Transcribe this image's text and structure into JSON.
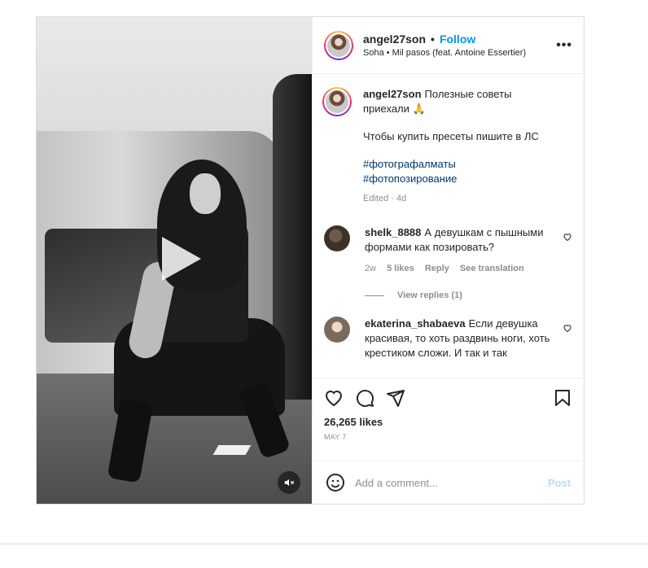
{
  "post": {
    "username": "angel27son",
    "follow_label": "Follow",
    "separator": "•",
    "audio": "Soha • Mil pasos (feat. Antoine Essertier)",
    "more_label": "•••"
  },
  "caption": {
    "username": "angel27son",
    "line1": "Полезные советы приехали 🙏",
    "line2": "Чтобы купить пресеты пишите в ЛС",
    "tags": [
      "#фотографалматы",
      "#фотопозирование"
    ],
    "meta": "Edited · 4d"
  },
  "comments": [
    {
      "username": "shelk_8888",
      "text": "А девушкам с пышными формами как позировать?",
      "time": "2w",
      "likes": "5 likes",
      "reply": "Reply",
      "translate": "See translation",
      "view_replies": "View replies (1)"
    },
    {
      "username": "ekaterina_shabaeva",
      "text": "Если девушка красивая, то хоть раздвинь ноги, хоть крестиком сложи. И так и так"
    }
  ],
  "likes": "26,265 likes",
  "date": "MAY 7",
  "add_comment": {
    "placeholder": "Add a comment...",
    "post_label": "Post"
  },
  "icons": {
    "like": "heart-icon",
    "comment": "comment-icon",
    "share": "send-icon",
    "save": "bookmark-icon",
    "emoji": "emoji-icon",
    "play": "play-icon",
    "mute": "mute-icon"
  },
  "colors": {
    "link": "#0095f6",
    "hashtag": "#00376b",
    "muted": "#8e8e8e"
  }
}
